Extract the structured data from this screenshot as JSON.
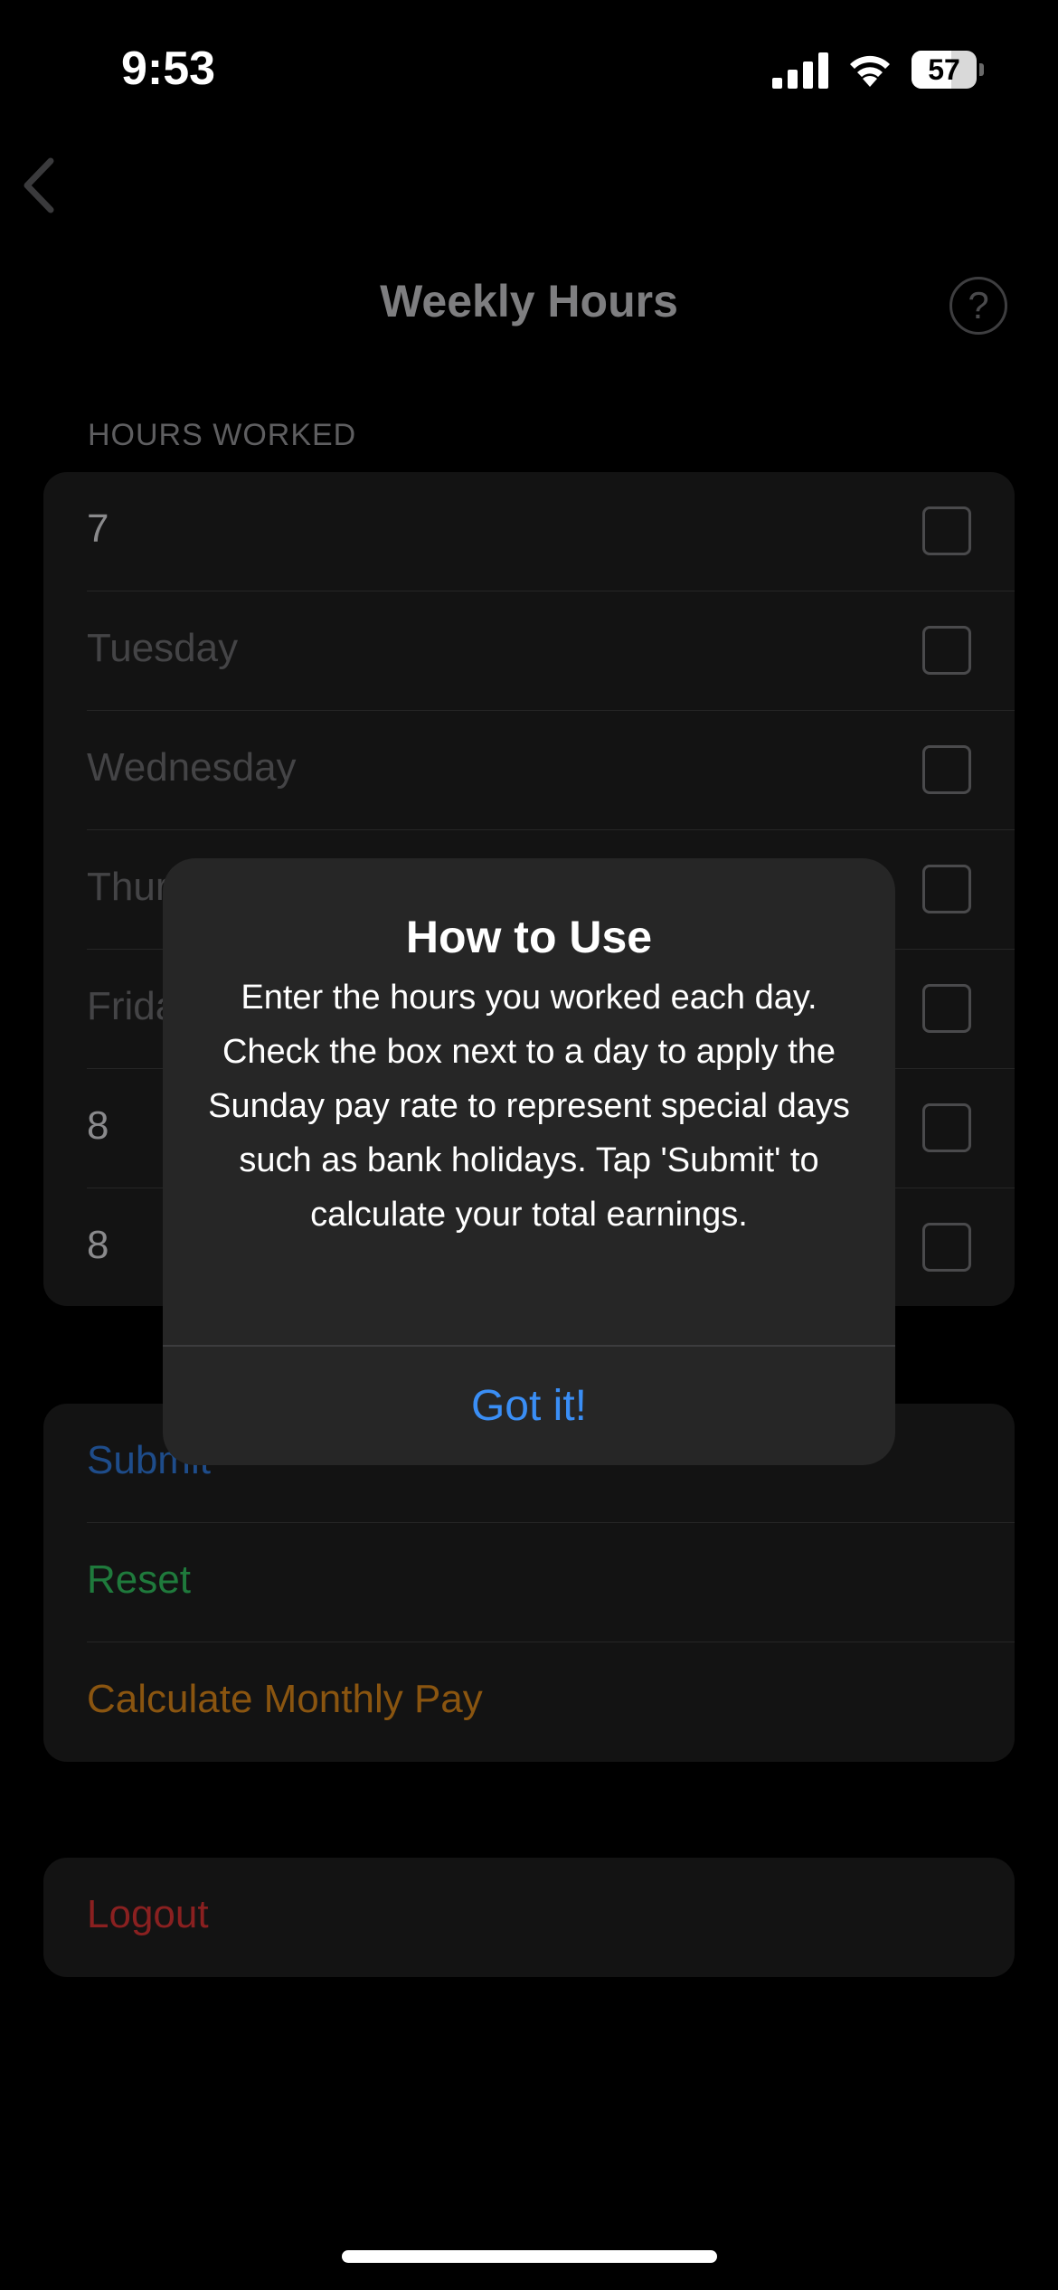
{
  "status_bar": {
    "time": "9:53",
    "battery": "57",
    "icons": [
      "signal-icon",
      "wifi-icon",
      "battery-icon"
    ]
  },
  "nav": {
    "title": "Weekly Hours",
    "back_icon": "chevron-left-icon",
    "help_icon": "question-mark-circle-icon",
    "help_glyph": "?"
  },
  "hours_section": {
    "label": "HOURS WORKED",
    "rows": [
      {
        "text": "7",
        "is_value": true,
        "checked": false
      },
      {
        "text": "Tuesday",
        "is_value": false,
        "checked": false
      },
      {
        "text": "Wednesday",
        "is_value": false,
        "checked": false
      },
      {
        "text": "Thursday",
        "is_value": false,
        "checked": false
      },
      {
        "text": "Friday",
        "is_value": false,
        "checked": false
      },
      {
        "text": "8",
        "is_value": true,
        "checked": false
      },
      {
        "text": "8",
        "is_value": true,
        "checked": false
      }
    ]
  },
  "actions": {
    "submit": "Submit",
    "reset": "Reset",
    "monthly": "Calculate Monthly Pay"
  },
  "logout": "Logout",
  "alert": {
    "title": "How to Use",
    "message": "Enter the hours you worked each day. Check the box next to a day to apply the Sunday pay rate to represent special days such as bank holidays. Tap 'Submit' to calculate your total earnings.",
    "button": "Got it!"
  },
  "colors": {
    "accent_blue": "#3a8ef5",
    "reset_green": "#1f7a3c",
    "monthly_orange": "#8a5510",
    "logout_red": "#8a2020"
  }
}
